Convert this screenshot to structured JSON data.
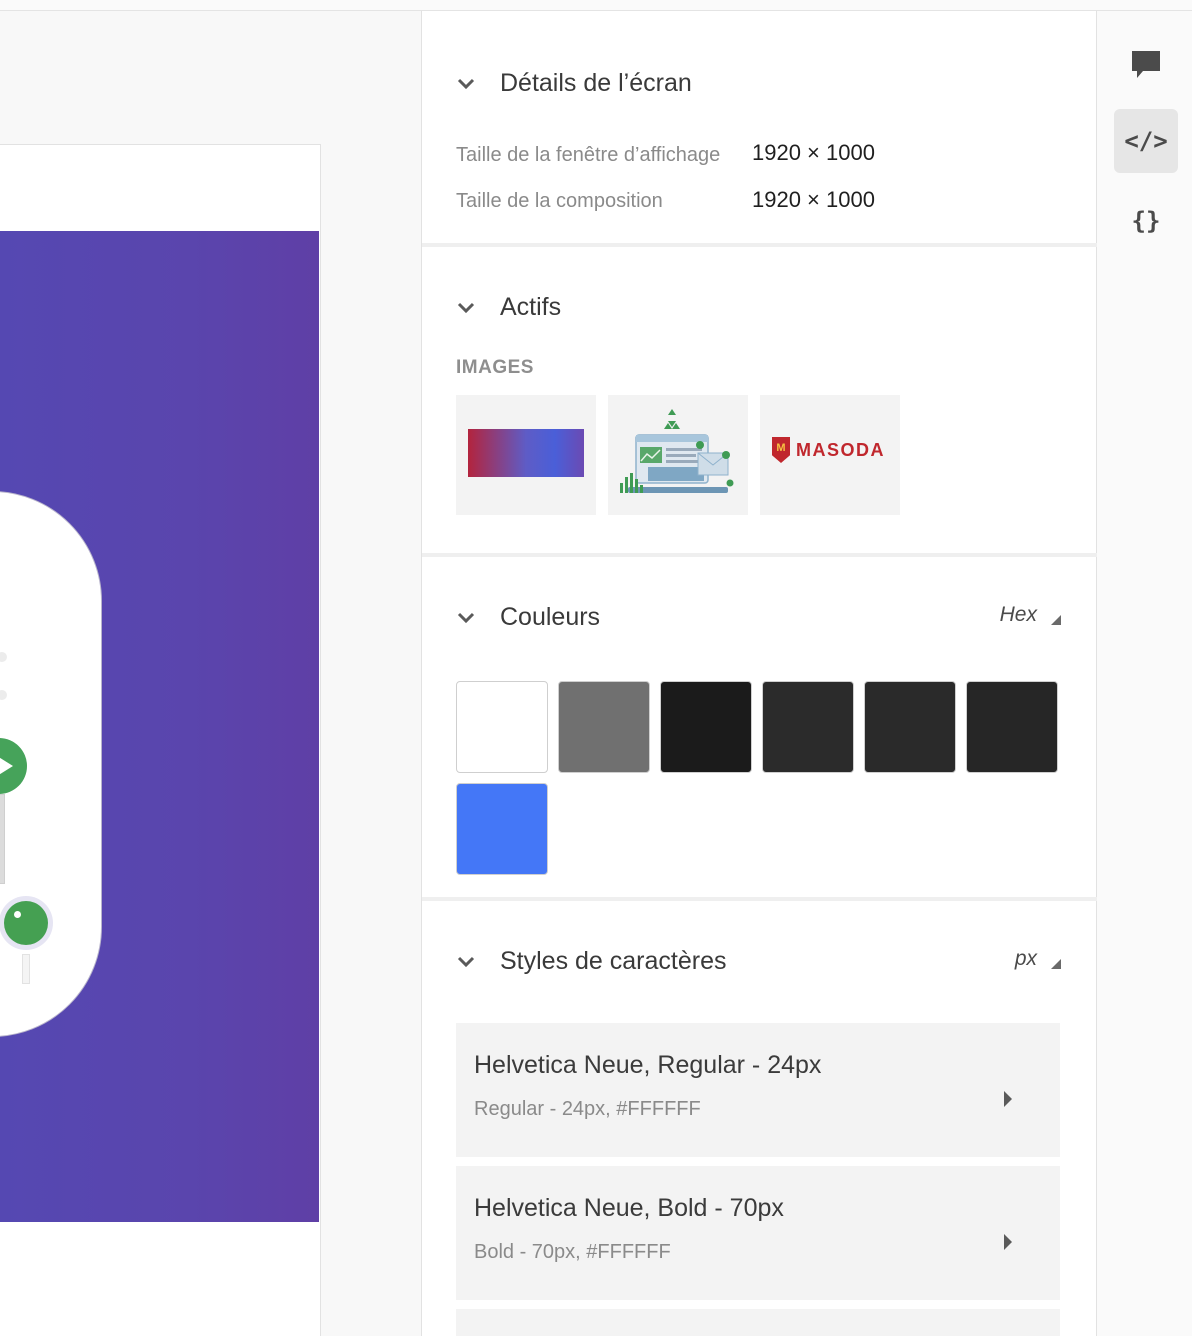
{
  "screen_details": {
    "title": "Détails de l’écran",
    "viewport_label": "Taille de la fenêtre d’affichage",
    "viewport_value": "1920 × 1000",
    "composition_label": "Taille de la composition",
    "composition_value": "1920 × 1000"
  },
  "assets": {
    "title": "Actifs",
    "images_label": "IMAGES",
    "images": [
      {
        "name": "gradient-background"
      },
      {
        "name": "illustration-dashboard"
      },
      {
        "name": "logo-masoda",
        "text": "MASODA",
        "mark": "M"
      }
    ]
  },
  "colors": {
    "title": "Couleurs",
    "format": "Hex",
    "swatches": [
      "#FFFFFF",
      "#707070",
      "#1B1B1B",
      "#2B2B2B",
      "#2A2A2A",
      "#262626",
      "#4477F7"
    ]
  },
  "char_styles": {
    "title": "Styles de caractères",
    "unit": "px",
    "items": [
      {
        "title": "Helvetica Neue, Regular - 24px",
        "subtitle": "Regular - 24px, #FFFFFF"
      },
      {
        "title": "Helvetica Neue, Bold - 70px",
        "subtitle": "Bold - 70px, #FFFFFF"
      }
    ]
  },
  "rail": {
    "comment_glyph": "",
    "code_glyph": "</>",
    "json_glyph": "{}"
  },
  "theme": {
    "hero_gradient_start": "#5548B2",
    "hero_gradient_end": "#5F3FA6",
    "accent_green": "#46A35A"
  }
}
